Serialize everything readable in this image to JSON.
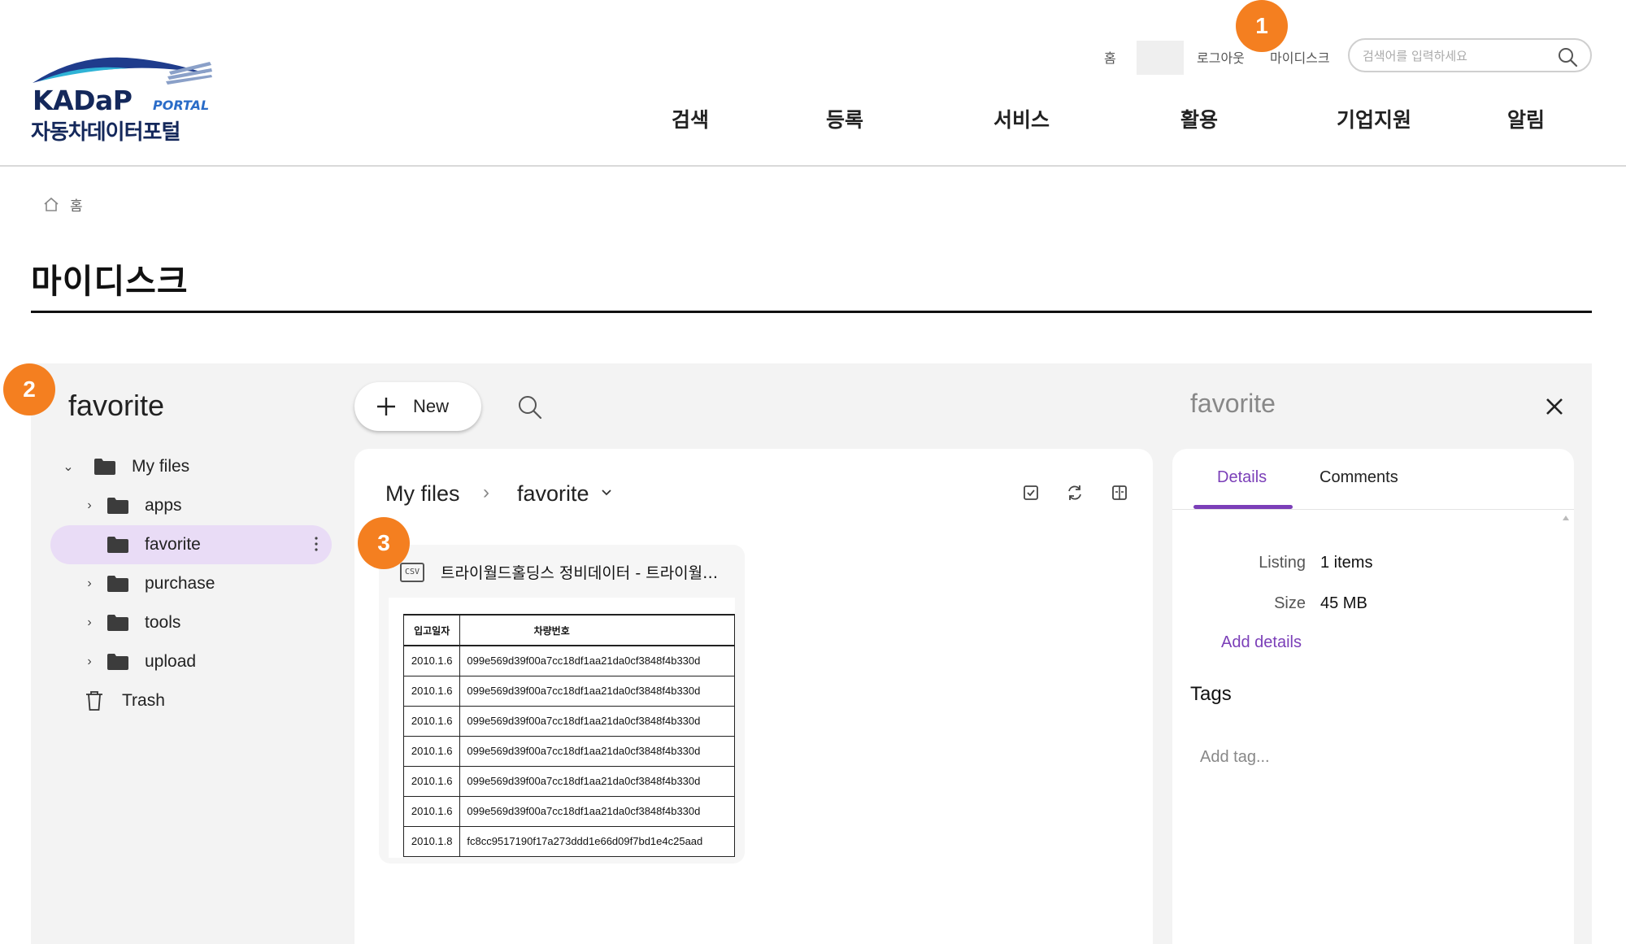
{
  "header": {
    "logo": {
      "brand": "KADaP",
      "portal": "PORTAL",
      "name_ko": "자동차데이터포털"
    },
    "util": {
      "home": "홈",
      "logout": "로그아웃",
      "mydisk": "마이디스크"
    },
    "search": {
      "placeholder": "검색어를 입력하세요"
    },
    "gnb": [
      "검색",
      "등록",
      "서비스",
      "활용",
      "기업지원",
      "알림"
    ]
  },
  "markers": [
    "1",
    "2",
    "3"
  ],
  "breadcrumb": {
    "home": "홈"
  },
  "page_title": "마이디스크",
  "sidebar": {
    "title": "favorite",
    "tree": [
      {
        "label": "My files"
      },
      {
        "label": "apps"
      },
      {
        "label": "favorite"
      },
      {
        "label": "purchase"
      },
      {
        "label": "tools"
      },
      {
        "label": "upload"
      },
      {
        "label": "Trash"
      }
    ]
  },
  "toolbar": {
    "new_label": "New"
  },
  "files": {
    "crumbs": [
      "My files",
      "favorite"
    ],
    "sep": "›",
    "card": {
      "type_label": "CSV",
      "name": "트라이월드홀딩스 정비데이터 - 트라이월드홀딩스 정비데이터",
      "table": {
        "headers": [
          "입고일자",
          "차량번호"
        ],
        "rows": [
          [
            "2010.1.6",
            "099e569d39f00a7cc18df1aa21da0cf3848f4b330d"
          ],
          [
            "2010.1.6",
            "099e569d39f00a7cc18df1aa21da0cf3848f4b330d"
          ],
          [
            "2010.1.6",
            "099e569d39f00a7cc18df1aa21da0cf3848f4b330d"
          ],
          [
            "2010.1.6",
            "099e569d39f00a7cc18df1aa21da0cf3848f4b330d"
          ],
          [
            "2010.1.6",
            "099e569d39f00a7cc18df1aa21da0cf3848f4b330d"
          ],
          [
            "2010.1.6",
            "099e569d39f00a7cc18df1aa21da0cf3848f4b330d"
          ],
          [
            "2010.1.8",
            "fc8cc9517190f17a273ddd1e66d09f7bd1e4c25aad"
          ]
        ]
      }
    }
  },
  "details": {
    "title": "favorite",
    "tabs": [
      "Details",
      "Comments"
    ],
    "listing_label": "Listing",
    "listing_value": "1 items",
    "size_label": "Size",
    "size_value": "45 MB",
    "add_details": "Add details",
    "tags_label": "Tags",
    "add_tag_placeholder": "Add tag..."
  },
  "colors": {
    "accent": "#7b3fb8",
    "marker": "#f47f20",
    "brand": "#14285b"
  }
}
